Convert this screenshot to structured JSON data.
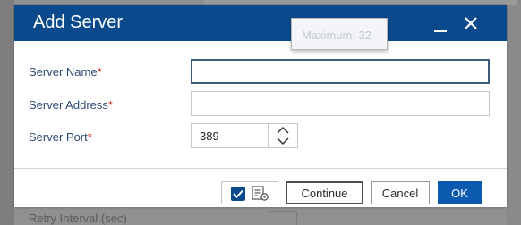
{
  "dialog": {
    "title": "Add Server"
  },
  "tooltip": {
    "text": "Maximum: 32"
  },
  "form": {
    "server_name": {
      "label": "Server Name",
      "required_mark": "*",
      "value": ""
    },
    "server_address": {
      "label": "Server Address",
      "required_mark": "*",
      "value": ""
    },
    "server_port": {
      "label": "Server Port",
      "required_mark": "*",
      "value": "389"
    }
  },
  "footer": {
    "checkbox_checked": true,
    "continue_label": "Continue",
    "cancel_label": "Cancel",
    "ok_label": "OK"
  },
  "background": {
    "partial_label": "Retry Interval (sec)"
  },
  "icons": {
    "minimize": "minimize-icon",
    "close": "close-icon",
    "spin_up": "chevron-up-icon",
    "spin_down": "chevron-down-icon",
    "checkbox": "checkmark-icon",
    "settings": "list-settings-icon"
  },
  "colors": {
    "title_bar": "#0a4a8c",
    "primary_button": "#0a5bb0",
    "label_text": "#2e4a73",
    "required": "#d02020"
  }
}
